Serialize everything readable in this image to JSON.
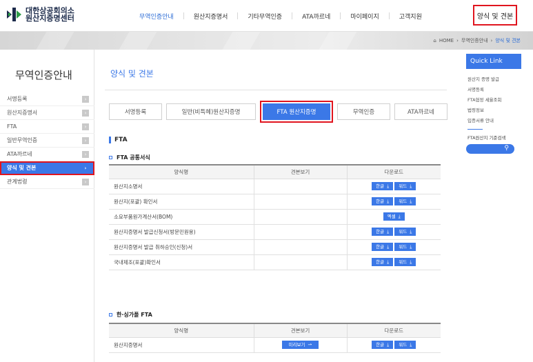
{
  "header": {
    "logo_line1": "대한상공회의소",
    "logo_line2": "원산지증명센터",
    "nav": [
      "무역인증안내",
      "원산지증명서",
      "기타무역인증",
      "ATA까르네",
      "마이페이지",
      "고객지원"
    ],
    "nav_highlight": "양식 및 견본"
  },
  "breadcrumb": {
    "home": "HOME",
    "level1": "무역인증안내",
    "current": "양식 및 견본"
  },
  "sidebar": {
    "title": "무역인증안내",
    "items": [
      "서명등록",
      "원산지증명서",
      "FTA",
      "일반무역인증",
      "ATA까르네",
      "양식 및 견본",
      "관계법령"
    ],
    "arrow": "›"
  },
  "content": {
    "page_title": "양식 및 견본",
    "tabs": [
      "서명등록",
      "일반(비특혜)원산지증명",
      "FTA 원산지증명",
      "무역인증",
      "ATA까르네"
    ],
    "section_title": "FTA",
    "table1": {
      "title": "FTA 공통서식",
      "headers": [
        "양식명",
        "견본보기",
        "다운로드"
      ],
      "rows": [
        {
          "name": "원산지소명서",
          "dl": [
            "한글",
            "워드"
          ]
        },
        {
          "name": "원산지(포괄) 확인서",
          "dl": [
            "한글",
            "워드"
          ]
        },
        {
          "name": "소요부품원가계산서(BOM)",
          "dl": [
            "엑셀"
          ]
        },
        {
          "name": "원산지증명서 발급신청서(방문민원용)",
          "dl": [
            "한글",
            "워드"
          ]
        },
        {
          "name": "원산지증명서 발급 취하승인(신청)서",
          "dl": [
            "한글",
            "워드"
          ]
        },
        {
          "name": "국내제조(포괄)확인서",
          "dl": [
            "한글",
            "워드"
          ]
        }
      ]
    },
    "table2": {
      "title": "한·싱가폴 FTA",
      "headers": [
        "양식명",
        "견본보기",
        "다운로드"
      ],
      "rows": [
        {
          "name": "원산지증명서",
          "preview": "미리보기",
          "dl": [
            "한글",
            "워드"
          ]
        }
      ]
    }
  },
  "quick_link": {
    "title": "Quick Link",
    "items": [
      "원산지 증명 발급",
      "서명등록",
      "FTA협정 세율조회",
      "법령정보",
      "입증서류 안내"
    ],
    "search_label": "FTA원산지 기준검색"
  },
  "colors": {
    "accent": "#3b78e7",
    "highlight": "#e0141e"
  }
}
